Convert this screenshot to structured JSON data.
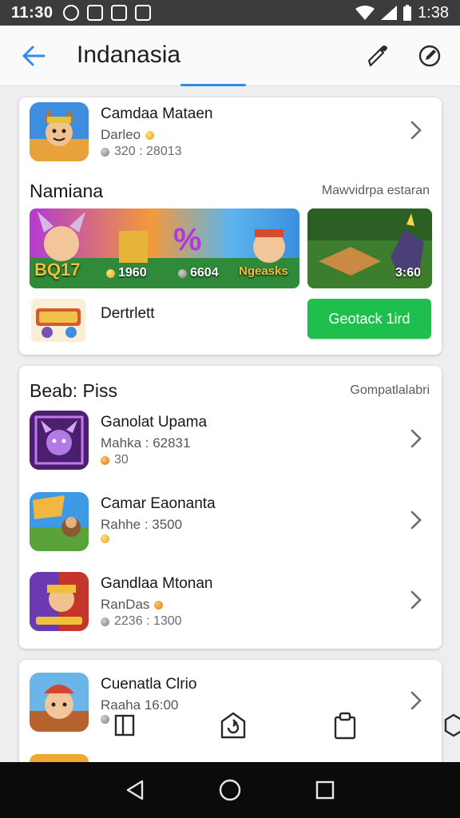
{
  "status_bar": {
    "time": "11:30",
    "battery": "1:38"
  },
  "app_bar": {
    "title": "Indanasia",
    "actions": [
      "pen-icon",
      "edit-circle-icon"
    ]
  },
  "card1": {
    "featured": {
      "name": "Camdaa Mataen",
      "developer": "Darleo",
      "meta": "320 : 28013"
    },
    "section_title": "Namiana",
    "section_link": "Mawvidrpa estaran",
    "banner_main": {
      "left_text": "BQ17",
      "stat1": "1960",
      "stat2": "6604",
      "right_text": "Ngeasks"
    },
    "banner_side": {
      "stat": "3:60"
    },
    "promo": {
      "label": "Dertrlett",
      "button": "Geotack 1ird"
    }
  },
  "card2": {
    "section_title": "Beab: Piss",
    "section_link": "Gompatlalabri",
    "items": [
      {
        "name": "Ganolat Upama",
        "developer": "Mahka : 62831",
        "meta": "30"
      },
      {
        "name": "Camar Eaonanta",
        "developer": "Rahhe : 3500",
        "meta": ""
      },
      {
        "name": "Gandlaa Mtonan",
        "developer": "RanDas",
        "meta": "2236 : 1300"
      }
    ]
  },
  "card3": {
    "item": {
      "name": "Cuenatla Clrio",
      "developer": "Raaha 16:00",
      "meta": ""
    }
  },
  "colors": {
    "accent": "#2f8de6",
    "install_button": "#1fbf4d",
    "status_bar": "#3c3c3f",
    "nav_bar": "#0b0b0c"
  }
}
